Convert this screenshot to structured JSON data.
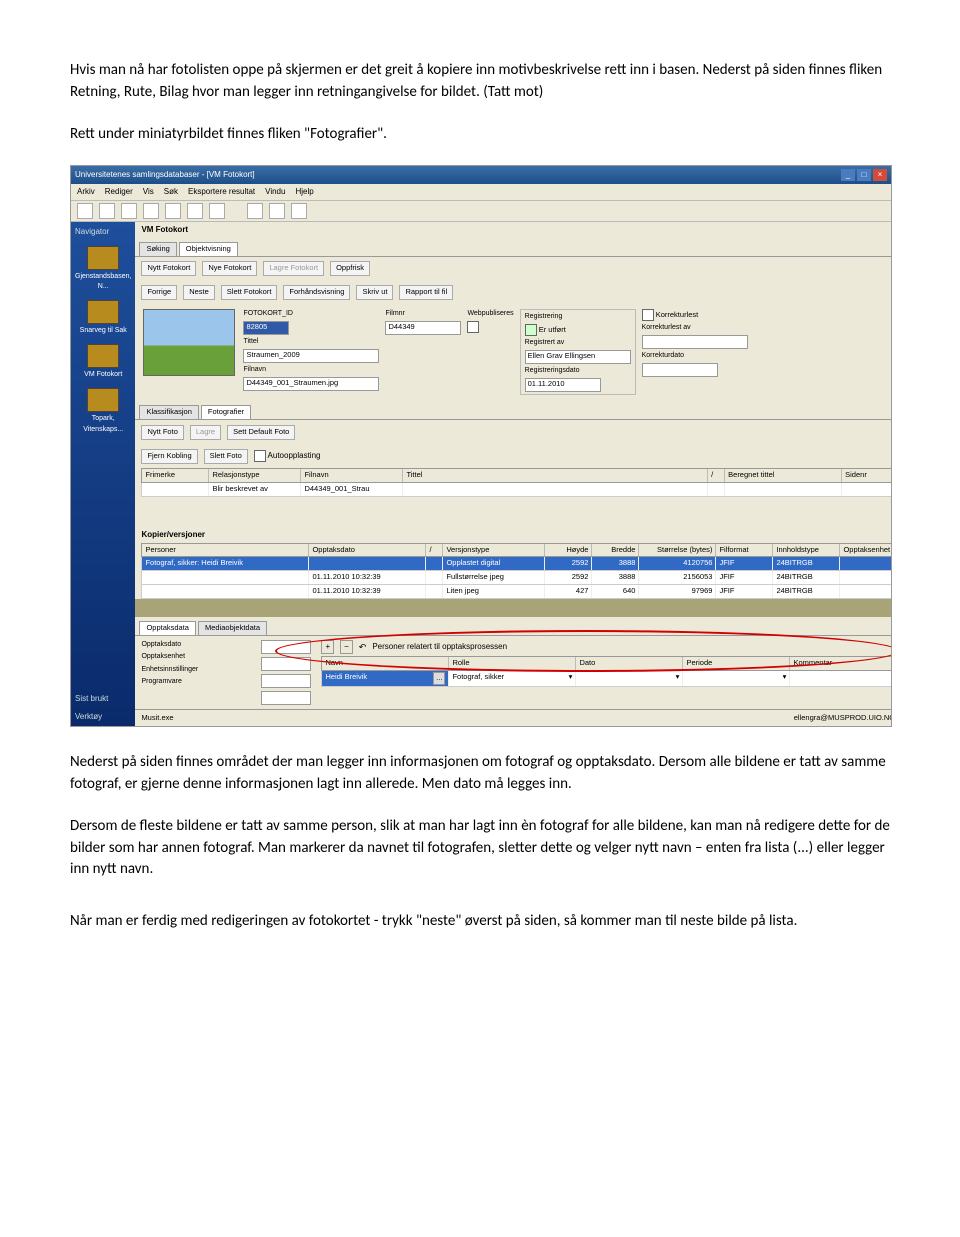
{
  "paragraphs": {
    "p1": "Hvis man nå har fotolisten oppe på skjermen er det greit å kopiere inn motivbeskrivelse rett inn i basen. Nederst på siden finnes fliken Retning, Rute, Bilag hvor man legger inn retningangivelse for bildet. (Tatt mot)",
    "p2": "Rett under miniatyrbildet finnes fliken \"Fotografier\".",
    "p3": "Nederst på siden finnes området der man legger inn informasjonen om fotograf og opptaksdato. Dersom alle bildene er tatt av samme fotograf, er gjerne denne informasjonen lagt inn allerede. Men dato må legges inn.",
    "p4": "Dersom de fleste bildene er tatt av samme person, slik at man har lagt inn èn fotograf for alle bildene, kan man nå redigere dette for de bilder som har annen fotograf. Man markerer da navnet til fotografen, sletter dette og velger nytt navn – enten fra lista (...) eller legger inn nytt navn.",
    "p5": "Når man er ferdig med redigeringen av fotokortet  - trykk \"neste\" øverst på siden, så kommer man til neste bilde på lista."
  },
  "app": {
    "title": "Universitetenes samlingsdatabaser - [VM Fotokort]",
    "menubar": [
      "Arkiv",
      "Rediger",
      "Vis",
      "Søk",
      "Eksportere resultat",
      "Vindu",
      "Hjelp"
    ],
    "statusbar_left": "Musit.exe",
    "statusbar_right": "ellengra@MUSPROD.UIO.NO"
  },
  "sidebar": {
    "header": "Navigator",
    "items": [
      "Gjenstandsbasen, N...",
      "Snarveg til Sak",
      "VM Fotokort",
      "Topark, Vitenskaps..."
    ],
    "bottom": [
      "Sist brukt",
      "Verktøy"
    ]
  },
  "topbar": {
    "doc_title": "VM Fotokort",
    "tabs_main": [
      "Søking",
      "Objektvisning"
    ],
    "buttons1": [
      "Nytt Fotokort",
      "Nye Fotokort",
      "Lagre Fotokort",
      "Oppfrisk"
    ],
    "buttons2": [
      "Forrige",
      "Neste",
      "Slett Fotokort",
      "Forhåndsvisning",
      "Skriv ut",
      "Rapport til fil"
    ]
  },
  "fotokort": {
    "fields": {
      "fotokort_id_label": "FOTOKORT_ID",
      "fotokort_id": "82805",
      "filmnr_label": "Filmnr",
      "filmnr": "D44349",
      "webpubliseres_label": "Webpubliseres",
      "tittel_label": "Tittel",
      "tittel": "Straumen_2009",
      "filnavn_label": "Filnavn",
      "filnavn": "D44349_001_Straumen.jpg",
      "reg_box": "Registrering",
      "er_utfort": "Er utført",
      "registrert_av_label": "Registrert av",
      "registrert_av": "Ellen Grav Ellingsen",
      "registreringsdato_label": "Registreringsdato",
      "registreringsdato": "01.11.2010",
      "korrekturlest": "Korrekturlest",
      "korrekturlest_av_label": "Korrekturlest av",
      "korrekturdato_label": "Korrekturdato"
    }
  },
  "subtabs": [
    "Klassifikasjon",
    "Fotografier"
  ],
  "subtoolbar": [
    "Nytt Foto",
    "Lagre",
    "Sett Default Foto",
    "Fjern Kobling",
    "Slett Foto",
    "Autoopplasting"
  ],
  "foto_grid": {
    "headers": [
      "Frimerke",
      "Relasjonstype",
      "Filnavn",
      "Tittel",
      "/",
      "Beregnet tittel",
      "Sidenr"
    ],
    "row": [
      "",
      "Blir beskrevet av",
      "D44349_001_Strau",
      "",
      "",
      "",
      ""
    ]
  },
  "kopier": {
    "header": "Kopier/versjoner",
    "col_headers": [
      "Personer",
      "Opptaksdato",
      "/",
      "Versjonstype",
      "Høyde",
      "Bredde",
      "Størrelse (bytes)",
      "Filformat",
      "Innholdstype",
      "Opptaksenhet"
    ],
    "rows": [
      [
        "Fotograf, sikker: Heidi Breivik",
        "",
        "",
        "Opplastet digital",
        "2592",
        "3888",
        "4120756",
        "JFIF",
        "24BITRGB",
        ""
      ],
      [
        "",
        "01.11.2010 10:32:39",
        "",
        "Fullstørrelse jpeg",
        "2592",
        "3888",
        "2156053",
        "JFIF",
        "24BITRGB",
        ""
      ],
      [
        "",
        "01.11.2010 10:32:39",
        "",
        "Liten jpeg",
        "427",
        "640",
        "97969",
        "JFIF",
        "24BITRGB",
        ""
      ]
    ]
  },
  "lower_tabs": [
    "Opptaksdata",
    "Mediaobjektdata"
  ],
  "opptaks_left": [
    "Opptaksdato",
    "Opptaksenhet",
    "Enhetsinnstillinger",
    "Programvare"
  ],
  "personer": {
    "title": "Personer relatert til opptaksprosessen",
    "headers": [
      "Navn",
      "Rolle",
      "Dato",
      "Periode",
      "Kommentar"
    ],
    "row": [
      "Heidi Breivik",
      "Fotograf, sikker",
      "",
      "",
      ""
    ]
  }
}
